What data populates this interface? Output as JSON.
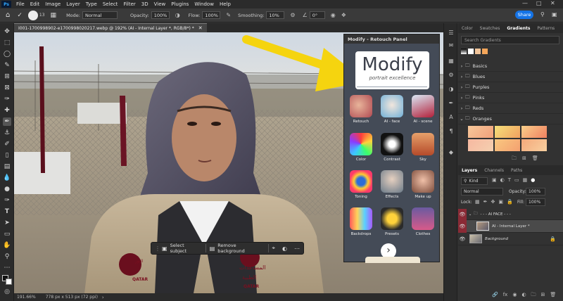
{
  "menubar": {
    "logo": "Ps",
    "items": [
      "File",
      "Edit",
      "Image",
      "Layer",
      "Type",
      "Select",
      "Filter",
      "3D",
      "View",
      "Plugins",
      "Window",
      "Help"
    ]
  },
  "options": {
    "mode_label": "Mode:",
    "mode_value": "Normal",
    "opacity_label": "Opacity:",
    "opacity_value": "100%",
    "flow_label": "Flow:",
    "flow_value": "100%",
    "smoothing_label": "Smoothing:",
    "smoothing_value": "10%",
    "angle_value": "0°",
    "size_value": "13",
    "share_label": "Share"
  },
  "document": {
    "tab_title": "I001-1700998902-e1700998020217.webp @ 192% (AI - Internal Layer *, RGB/8*) *",
    "zoom": "191.66%",
    "doc_info": "778 px x 513 px (72 ppi)"
  },
  "plugin": {
    "title": "Modify - Retouch Panel",
    "brand": "Modify",
    "tagline": "portrait excellence",
    "tiles": [
      "Retouch",
      "AI - face",
      "AI - scene",
      "Color",
      "Contrast",
      "Sky",
      "Toning",
      "Effects",
      "Make up",
      "Backdrops",
      "Presets",
      "Clothes"
    ]
  },
  "context_bar": {
    "select_subject": "Select subject",
    "remove_background": "Remove background"
  },
  "vest_text": {
    "line1": "النور",
    "line2": "QATAR",
    "line3": "المساعدات",
    "line4": "الطبية",
    "line5": "QATAR"
  },
  "right_panel": {
    "top_tabs": [
      "Color",
      "Swatches",
      "Gradients",
      "Patterns"
    ],
    "search_placeholder": "Search Gradients",
    "gradient_folders": [
      "Basics",
      "Blues",
      "Purples",
      "Pinks",
      "Reds",
      "Oranges"
    ],
    "layer_tabs": [
      "Layers",
      "Channels",
      "Paths"
    ],
    "kind_label": "Kind",
    "blend_mode": "Normal",
    "opacity_label": "Opacity:",
    "opacity_value": "100%",
    "lock_label": "Lock:",
    "fill_label": "Fill:",
    "fill_value": "100%",
    "layers": [
      {
        "name": "- - - AI FACE - - -"
      },
      {
        "name": "AI - Internal Layer *"
      },
      {
        "name": "Background"
      }
    ]
  },
  "colors": {
    "accent": "#1473e6",
    "arrow": "#f5d40f",
    "selected_layer": "#4a4a4a"
  }
}
